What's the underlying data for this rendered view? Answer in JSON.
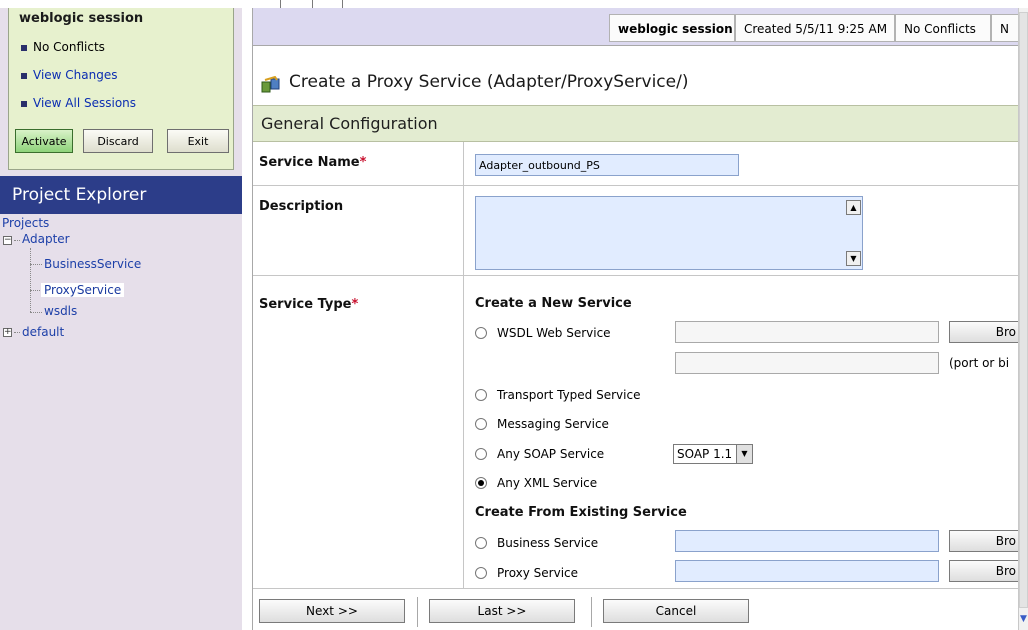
{
  "change_center": {
    "session_title": "weblogic session",
    "items": [
      "No Conflicts",
      "View Changes",
      "View All Sessions"
    ],
    "buttons": {
      "activate": "Activate",
      "discard": "Discard",
      "exit": "Exit"
    }
  },
  "project_explorer": {
    "title": "Project Explorer",
    "root": "Projects",
    "tree": {
      "adapter": "Adapter",
      "business_service": "BusinessService",
      "proxy_service": "ProxyService",
      "wsdls": "wsdls",
      "default": "default"
    }
  },
  "session_bar": {
    "session": "weblogic session",
    "created": "Created 5/5/11 9:25 AM",
    "conflicts": "No Conflicts",
    "extra": "N"
  },
  "page": {
    "title": "Create a Proxy Service (Adapter/ProxyService/)",
    "section": "General Configuration"
  },
  "form": {
    "service_name_label": "Service Name",
    "service_name_value": "Adapter_outbound_PS",
    "description_label": "Description",
    "service_type_label": "Service Type",
    "required_marker": "*",
    "create_new_title": "Create a New Service",
    "wsdl_web_service": "WSDL Web Service",
    "browse": "Bro",
    "port_note": "(port or bi",
    "transport_typed": "Transport Typed Service",
    "messaging": "Messaging Service",
    "any_soap": "Any SOAP Service",
    "soap_version": "SOAP 1.1",
    "any_xml": "Any XML Service",
    "selected_type": "Any XML Service",
    "create_existing_title": "Create From Existing Service",
    "business_service": "Business Service",
    "proxy_service": "Proxy Service"
  },
  "footer": {
    "next": "Next >>",
    "last": "Last >>",
    "cancel": "Cancel"
  }
}
